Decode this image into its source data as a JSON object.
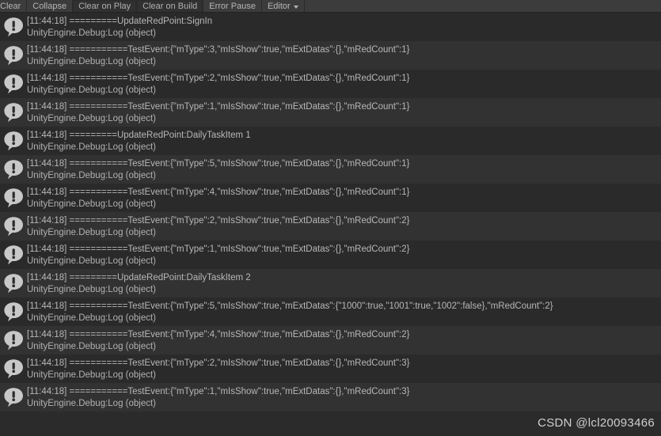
{
  "window": {
    "title": "Console",
    "colors": {
      "toolbar_bg": "#3c3c3c",
      "row_even_bg": "#2a2a2a",
      "row_odd_bg": "#323232",
      "text": "#b7b7b7",
      "icon": "#c8c8c8"
    }
  },
  "toolbar": {
    "buttons": [
      {
        "label": "Clear",
        "pressed": false
      },
      {
        "label": "Collapse",
        "pressed": false
      },
      {
        "label": "Clear on Play",
        "pressed": true
      },
      {
        "label": "Clear on Build",
        "pressed": true
      },
      {
        "label": "Error Pause",
        "pressed": false
      }
    ],
    "dropdown": {
      "label": "Editor",
      "caret": "chevron-down-icon"
    }
  },
  "log": {
    "icon_name": "log-message-icon",
    "entries": [
      {
        "line1": "[11:44:18] =========UpdateRedPoint:SignIn",
        "line2": "UnityEngine.Debug:Log (object)"
      },
      {
        "line1": "[11:44:18] ===========TestEvent:{\"mType\":3,\"mIsShow\":true,\"mExtDatas\":{},\"mRedCount\":1}",
        "line2": "UnityEngine.Debug:Log (object)"
      },
      {
        "line1": "[11:44:18] ===========TestEvent:{\"mType\":2,\"mIsShow\":true,\"mExtDatas\":{},\"mRedCount\":1}",
        "line2": "UnityEngine.Debug:Log (object)"
      },
      {
        "line1": "[11:44:18] ===========TestEvent:{\"mType\":1,\"mIsShow\":true,\"mExtDatas\":{},\"mRedCount\":1}",
        "line2": "UnityEngine.Debug:Log (object)"
      },
      {
        "line1": "[11:44:18] =========UpdateRedPoint:DailyTaskItem  1",
        "line2": "UnityEngine.Debug:Log (object)"
      },
      {
        "line1": "[11:44:18] ===========TestEvent:{\"mType\":5,\"mIsShow\":true,\"mExtDatas\":{},\"mRedCount\":1}",
        "line2": "UnityEngine.Debug:Log (object)"
      },
      {
        "line1": "[11:44:18] ===========TestEvent:{\"mType\":4,\"mIsShow\":true,\"mExtDatas\":{},\"mRedCount\":1}",
        "line2": "UnityEngine.Debug:Log (object)"
      },
      {
        "line1": "[11:44:18] ===========TestEvent:{\"mType\":2,\"mIsShow\":true,\"mExtDatas\":{},\"mRedCount\":2}",
        "line2": "UnityEngine.Debug:Log (object)"
      },
      {
        "line1": "[11:44:18] ===========TestEvent:{\"mType\":1,\"mIsShow\":true,\"mExtDatas\":{},\"mRedCount\":2}",
        "line2": "UnityEngine.Debug:Log (object)"
      },
      {
        "line1": "[11:44:18] =========UpdateRedPoint:DailyTaskItem  2",
        "line2": "UnityEngine.Debug:Log (object)"
      },
      {
        "line1": "[11:44:18] ===========TestEvent:{\"mType\":5,\"mIsShow\":true,\"mExtDatas\":{\"1000\":true,\"1001\":true,\"1002\":false},\"mRedCount\":2}",
        "line2": "UnityEngine.Debug:Log (object)"
      },
      {
        "line1": "[11:44:18] ===========TestEvent:{\"mType\":4,\"mIsShow\":true,\"mExtDatas\":{},\"mRedCount\":2}",
        "line2": "UnityEngine.Debug:Log (object)"
      },
      {
        "line1": "[11:44:18] ===========TestEvent:{\"mType\":2,\"mIsShow\":true,\"mExtDatas\":{},\"mRedCount\":3}",
        "line2": "UnityEngine.Debug:Log (object)"
      },
      {
        "line1": "[11:44:18] ===========TestEvent:{\"mType\":1,\"mIsShow\":true,\"mExtDatas\":{},\"mRedCount\":3}",
        "line2": "UnityEngine.Debug:Log (object)"
      }
    ]
  },
  "watermark": {
    "text": "CSDN @lcl20093466"
  }
}
